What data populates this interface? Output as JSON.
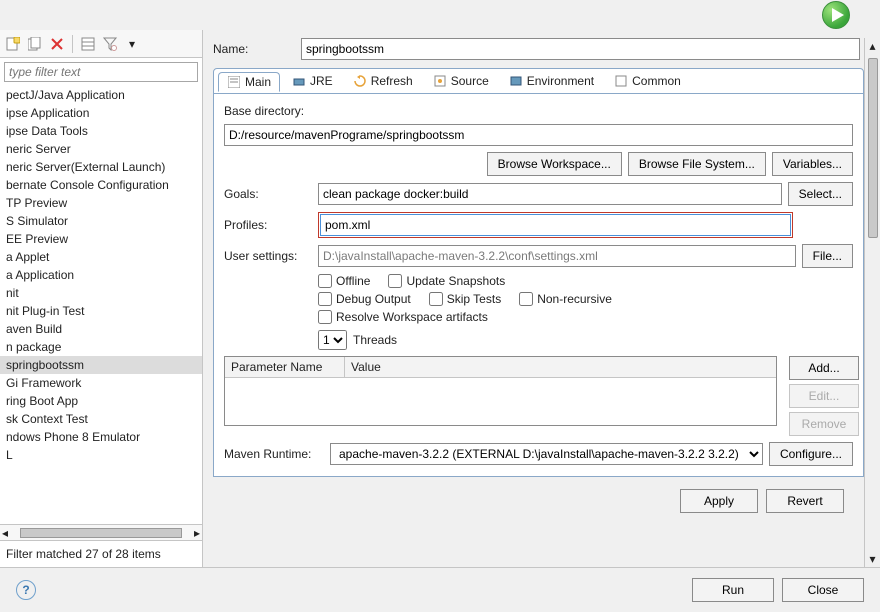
{
  "name_label": "Name:",
  "name_value": "springbootssm",
  "left": {
    "filter_placeholder": "type filter text",
    "items": [
      "pectJ/Java Application",
      "ipse Application",
      "ipse Data Tools",
      "neric Server",
      "neric Server(External Launch)",
      "bernate Console Configuration",
      "TP Preview",
      "S Simulator",
      "EE Preview",
      "a Applet",
      "a Application",
      "nit",
      "nit Plug-in Test",
      "aven Build",
      "n package",
      "springbootssm",
      "Gi Framework",
      "ring Boot App",
      "sk Context Test",
      "ndows Phone 8 Emulator",
      "L"
    ],
    "selected_index": 15,
    "status": "Filter matched 27 of 28 items"
  },
  "tabs": {
    "items": [
      "Main",
      "JRE",
      "Refresh",
      "Source",
      "Environment",
      "Common"
    ],
    "active": 0
  },
  "main_tab": {
    "base_dir_label": "Base directory:",
    "base_dir_value": "D:/resource/mavenPrograme/springbootssm",
    "browse_workspace": "Browse Workspace...",
    "browse_fs": "Browse File System...",
    "variables_btn": "Variables...",
    "goals_label": "Goals:",
    "goals_value": "clean package docker:build",
    "select_btn": "Select...",
    "profiles_label": "Profiles:",
    "profiles_value": "pom.xml",
    "user_settings_label": "User settings:",
    "user_settings_value": "D:\\javaInstall\\apache-maven-3.2.2\\conf\\settings.xml",
    "file_btn": "File...",
    "chk_offline": "Offline",
    "chk_update_snapshots": "Update Snapshots",
    "chk_debug_output": "Debug Output",
    "chk_skip_tests": "Skip Tests",
    "chk_non_recursive": "Non-recursive",
    "chk_resolve_workspace": "Resolve Workspace artifacts",
    "threads_label": "Threads",
    "threads_value": "1",
    "param_name_col": "Parameter Name",
    "param_value_col": "Value",
    "add_btn": "Add...",
    "edit_btn": "Edit...",
    "remove_btn": "Remove",
    "runtime_label": "Maven Runtime:",
    "runtime_value": "apache-maven-3.2.2 (EXTERNAL D:\\javaInstall\\apache-maven-3.2.2 3.2.2)",
    "configure_btn": "Configure..."
  },
  "buttons": {
    "apply": "Apply",
    "revert": "Revert",
    "run": "Run",
    "close": "Close"
  }
}
